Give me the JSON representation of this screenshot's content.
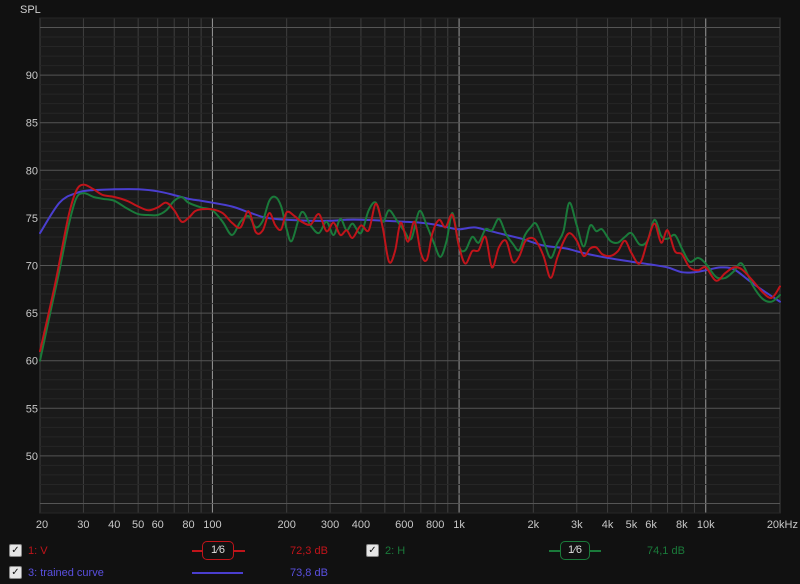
{
  "chart_data": {
    "type": "line",
    "ylabel": "SPL",
    "xscale": "log",
    "xlim": [
      20,
      20000
    ],
    "ylim": [
      44,
      96
    ],
    "yticks": [
      50,
      55,
      60,
      65,
      70,
      75,
      80,
      85,
      90
    ],
    "xticks": [
      {
        "v": 20,
        "label": "20"
      },
      {
        "v": 30,
        "label": "30"
      },
      {
        "v": 40,
        "label": "40"
      },
      {
        "v": 50,
        "label": "50"
      },
      {
        "v": 60,
        "label": "60"
      },
      {
        "v": 80,
        "label": "80"
      },
      {
        "v": 100,
        "label": "100"
      },
      {
        "v": 200,
        "label": "200"
      },
      {
        "v": 300,
        "label": "300"
      },
      {
        "v": 400,
        "label": "400"
      },
      {
        "v": 600,
        "label": "600"
      },
      {
        "v": 800,
        "label": "800"
      },
      {
        "v": 1000,
        "label": "1k"
      },
      {
        "v": 2000,
        "label": "2k"
      },
      {
        "v": 3000,
        "label": "3k"
      },
      {
        "v": 4000,
        "label": "4k"
      },
      {
        "v": 5000,
        "label": "5k"
      },
      {
        "v": 6000,
        "label": "6k"
      },
      {
        "v": 8000,
        "label": "8k"
      },
      {
        "v": 10000,
        "label": "10k"
      },
      {
        "v": 20000,
        "label": "20kHz"
      }
    ],
    "grid": true,
    "series": [
      {
        "name": "1: V",
        "color": "#c0141a",
        "smoothing": "1/6",
        "value_label": "72,3 dB",
        "points": [
          [
            20,
            61
          ],
          [
            23,
            68
          ],
          [
            26,
            75
          ],
          [
            28,
            77.8
          ],
          [
            30,
            78.5
          ],
          [
            33,
            78
          ],
          [
            36,
            77.4
          ],
          [
            40,
            77.2
          ],
          [
            45,
            76.8
          ],
          [
            50,
            76.2
          ],
          [
            55,
            75.8
          ],
          [
            60,
            76.1
          ],
          [
            65,
            76.6
          ],
          [
            70,
            75.8
          ],
          [
            75,
            74.6
          ],
          [
            80,
            75
          ],
          [
            85,
            75.7
          ],
          [
            90,
            75.9
          ],
          [
            100,
            75.9
          ],
          [
            110,
            75.5
          ],
          [
            120,
            74.5
          ],
          [
            130,
            74
          ],
          [
            140,
            75.7
          ],
          [
            150,
            73.5
          ],
          [
            160,
            73.7
          ],
          [
            170,
            75.5
          ],
          [
            180,
            74.2
          ],
          [
            190,
            73.8
          ],
          [
            200,
            75.6
          ],
          [
            215,
            75.2
          ],
          [
            230,
            74.6
          ],
          [
            250,
            74.3
          ],
          [
            270,
            75.4
          ],
          [
            290,
            73.6
          ],
          [
            310,
            74.5
          ],
          [
            330,
            73.2
          ],
          [
            350,
            73.7
          ],
          [
            370,
            72.9
          ],
          [
            400,
            74.2
          ],
          [
            430,
            73.7
          ],
          [
            460,
            76.5
          ],
          [
            490,
            74
          ],
          [
            520,
            70.4
          ],
          [
            550,
            71.5
          ],
          [
            580,
            74.5
          ],
          [
            620,
            72.5
          ],
          [
            660,
            74.6
          ],
          [
            700,
            71.3
          ],
          [
            740,
            70.6
          ],
          [
            780,
            73.4
          ],
          [
            830,
            74.8
          ],
          [
            880,
            74
          ],
          [
            940,
            75.3
          ],
          [
            1000,
            72
          ],
          [
            1060,
            70.2
          ],
          [
            1130,
            71.5
          ],
          [
            1200,
            71.6
          ],
          [
            1280,
            73
          ],
          [
            1360,
            69.8
          ],
          [
            1450,
            71.9
          ],
          [
            1550,
            72.6
          ],
          [
            1650,
            70.4
          ],
          [
            1750,
            70.9
          ],
          [
            1850,
            72.5
          ],
          [
            1950,
            72.9
          ],
          [
            2050,
            72.6
          ],
          [
            2200,
            71
          ],
          [
            2350,
            68.7
          ],
          [
            2500,
            70.8
          ],
          [
            2650,
            72.5
          ],
          [
            2800,
            73.4
          ],
          [
            3000,
            72.6
          ],
          [
            3200,
            71
          ],
          [
            3400,
            71.8
          ],
          [
            3600,
            71.9
          ],
          [
            3800,
            71.2
          ],
          [
            4100,
            71
          ],
          [
            4400,
            71.5
          ],
          [
            4700,
            72.6
          ],
          [
            5000,
            71.3
          ],
          [
            5400,
            70.2
          ],
          [
            5800,
            72.5
          ],
          [
            6200,
            74.4
          ],
          [
            6600,
            72.4
          ],
          [
            7000,
            73.7
          ],
          [
            7500,
            71.5
          ],
          [
            8000,
            71.2
          ],
          [
            8600,
            69.8
          ],
          [
            9300,
            69.5
          ],
          [
            10000,
            69.8
          ],
          [
            11000,
            68.4
          ],
          [
            12000,
            69.2
          ],
          [
            13000,
            69.8
          ],
          [
            14000,
            69.6
          ],
          [
            15500,
            68.4
          ],
          [
            17000,
            67.2
          ],
          [
            18500,
            66.6
          ],
          [
            20000,
            67.8
          ]
        ]
      },
      {
        "name": "2: H",
        "color": "#1a7a3a",
        "smoothing": "1/6",
        "value_label": "74,1 dB",
        "points": [
          [
            20,
            60
          ],
          [
            22,
            65
          ],
          [
            24,
            69.5
          ],
          [
            26,
            74
          ],
          [
            28,
            77
          ],
          [
            30,
            77.6
          ],
          [
            33,
            77.2
          ],
          [
            36,
            77
          ],
          [
            40,
            76.8
          ],
          [
            45,
            76
          ],
          [
            50,
            75.4
          ],
          [
            55,
            75.3
          ],
          [
            60,
            75.3
          ],
          [
            65,
            75.8
          ],
          [
            70,
            76.8
          ],
          [
            75,
            77.2
          ],
          [
            80,
            76.6
          ],
          [
            90,
            76.1
          ],
          [
            100,
            75.8
          ],
          [
            110,
            74.6
          ],
          [
            120,
            73.2
          ],
          [
            130,
            74.6
          ],
          [
            140,
            75.2
          ],
          [
            150,
            74
          ],
          [
            160,
            74.7
          ],
          [
            170,
            76.8
          ],
          [
            180,
            77.2
          ],
          [
            190,
            76.2
          ],
          [
            200,
            73.8
          ],
          [
            210,
            72.6
          ],
          [
            230,
            75.6
          ],
          [
            250,
            74.2
          ],
          [
            270,
            73.4
          ],
          [
            290,
            74.6
          ],
          [
            310,
            73.2
          ],
          [
            330,
            74.9
          ],
          [
            350,
            73.7
          ],
          [
            370,
            74.4
          ],
          [
            400,
            73.4
          ],
          [
            430,
            75.8
          ],
          [
            460,
            76.6
          ],
          [
            490,
            74.6
          ],
          [
            520,
            75.8
          ],
          [
            560,
            74.7
          ],
          [
            600,
            73.6
          ],
          [
            640,
            72.8
          ],
          [
            690,
            75.7
          ],
          [
            740,
            74.2
          ],
          [
            790,
            72.4
          ],
          [
            840,
            70.9
          ],
          [
            890,
            72.6
          ],
          [
            940,
            75.5
          ],
          [
            1000,
            72
          ],
          [
            1060,
            71.6
          ],
          [
            1130,
            73
          ],
          [
            1200,
            72.4
          ],
          [
            1280,
            73.8
          ],
          [
            1360,
            73.7
          ],
          [
            1450,
            74.9
          ],
          [
            1550,
            73.3
          ],
          [
            1650,
            72.3
          ],
          [
            1750,
            71.6
          ],
          [
            1850,
            73.2
          ],
          [
            1950,
            74
          ],
          [
            2050,
            74.4
          ],
          [
            2200,
            72.6
          ],
          [
            2350,
            70.8
          ],
          [
            2500,
            72.3
          ],
          [
            2650,
            73.6
          ],
          [
            2800,
            76.6
          ],
          [
            3000,
            74.2
          ],
          [
            3200,
            72
          ],
          [
            3400,
            74.2
          ],
          [
            3600,
            73.6
          ],
          [
            3800,
            73.8
          ],
          [
            4100,
            72.6
          ],
          [
            4400,
            72.4
          ],
          [
            4700,
            73
          ],
          [
            5000,
            73.4
          ],
          [
            5400,
            72.2
          ],
          [
            5800,
            72.6
          ],
          [
            6200,
            74.8
          ],
          [
            6600,
            73.1
          ],
          [
            7000,
            72.8
          ],
          [
            7500,
            73.2
          ],
          [
            8000,
            71.8
          ],
          [
            8600,
            70.4
          ],
          [
            9300,
            70.8
          ],
          [
            10000,
            70.2
          ],
          [
            11000,
            68.8
          ],
          [
            12000,
            68.7
          ],
          [
            13000,
            69.4
          ],
          [
            14000,
            70.2
          ],
          [
            15500,
            67.9
          ],
          [
            17000,
            66.5
          ],
          [
            18500,
            66.2
          ],
          [
            20000,
            66.9
          ]
        ]
      },
      {
        "name": "3: trained curve",
        "color": "#4a3ecf",
        "value_label": "73,8 dB",
        "points": [
          [
            20,
            73.4
          ],
          [
            24,
            76.6
          ],
          [
            28,
            77.6
          ],
          [
            32,
            77.9
          ],
          [
            40,
            78
          ],
          [
            50,
            78
          ],
          [
            60,
            77.8
          ],
          [
            70,
            77.4
          ],
          [
            80,
            77
          ],
          [
            90,
            76.8
          ],
          [
            100,
            76.6
          ],
          [
            120,
            76.2
          ],
          [
            140,
            75.6
          ],
          [
            160,
            75.1
          ],
          [
            180,
            74.9
          ],
          [
            200,
            74.8
          ],
          [
            250,
            74.7
          ],
          [
            300,
            74.7
          ],
          [
            350,
            74.8
          ],
          [
            400,
            74.8
          ],
          [
            500,
            74.7
          ],
          [
            600,
            74.6
          ],
          [
            700,
            74.5
          ],
          [
            800,
            74.3
          ],
          [
            900,
            74
          ],
          [
            1000,
            73.8
          ],
          [
            1150,
            74
          ],
          [
            1300,
            73.7
          ],
          [
            1500,
            73.3
          ],
          [
            1800,
            72.8
          ],
          [
            2200,
            72.1
          ],
          [
            2700,
            71.8
          ],
          [
            3200,
            71.3
          ],
          [
            4000,
            70.8
          ],
          [
            5000,
            70.4
          ],
          [
            6000,
            70.1
          ],
          [
            7000,
            69.8
          ],
          [
            8000,
            69.3
          ],
          [
            9000,
            69.3
          ],
          [
            10000,
            69.5
          ],
          [
            11500,
            69.8
          ],
          [
            13000,
            69.6
          ],
          [
            15000,
            68.4
          ],
          [
            17000,
            67.4
          ],
          [
            20000,
            66.2
          ]
        ]
      }
    ]
  },
  "legend": {
    "row1": {
      "label1": "1: V",
      "smooth1": "1⁄6",
      "value1": "72,3 dB",
      "label2": "2: H",
      "smooth2": "1⁄6",
      "value2": "74,1 dB"
    },
    "row2": {
      "label3": "3: trained curve",
      "value3": "73,8 dB"
    },
    "check_mark": "✓"
  }
}
